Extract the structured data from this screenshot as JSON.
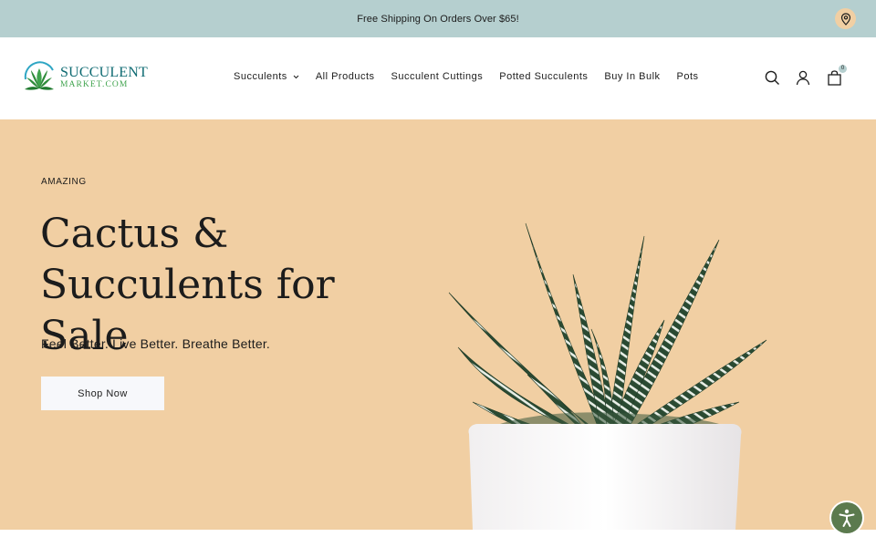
{
  "announcement": {
    "text": "Free Shipping On Orders Over $65!",
    "icon": "location-pin-icon"
  },
  "logo": {
    "name": "SUCCULENT",
    "sub": "MARKET.COM"
  },
  "nav": {
    "items": [
      {
        "label": "Succulents",
        "has_dropdown": true
      },
      {
        "label": "All Products"
      },
      {
        "label": "Succulent Cuttings"
      },
      {
        "label": "Potted Succulents"
      },
      {
        "label": "Buy In Bulk"
      },
      {
        "label": "Pots"
      }
    ]
  },
  "header_icons": {
    "search": "search-icon",
    "account": "user-icon",
    "cart": "shopping-bag-icon",
    "cart_count": "0"
  },
  "hero": {
    "eyebrow": "AMAZING",
    "title_line1": "Cactus &",
    "title_line2": "Succulents for Sale",
    "subtitle": "Feel Better. Live Better. Breathe Better.",
    "cta": "Shop Now"
  },
  "colors": {
    "announcement_bg": "#b5cfcf",
    "hero_bg": "#f1cfa3",
    "button_bg": "#f7f8fb",
    "accessibility_bg": "#5b7a4e",
    "logo_teal": "#0e6a72",
    "logo_green": "#3fa34d"
  }
}
